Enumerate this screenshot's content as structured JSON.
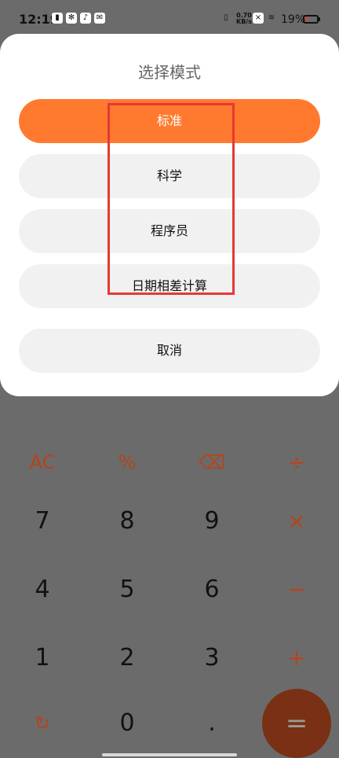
{
  "status": {
    "time": "12:19",
    "network_speed": "0.70 KB/s",
    "battery_percent": "19%",
    "icons": [
      "notification-icon",
      "settings-icon",
      "tiktok-icon",
      "mail-icon",
      "vibrate-icon",
      "close-icon",
      "wifi-icon",
      "battery-icon"
    ]
  },
  "modal": {
    "title": "选择模式",
    "options": [
      "标准",
      "科学",
      "程序员",
      "日期相差计算"
    ],
    "cancel": "取消",
    "selected_index": 0
  },
  "keypad": {
    "row1": [
      "AC",
      "%",
      "⌫",
      "÷"
    ],
    "row2": [
      "7",
      "8",
      "9",
      "×"
    ],
    "row3": [
      "4",
      "5",
      "6",
      "−"
    ],
    "row4": [
      "1",
      "2",
      "3",
      "+"
    ],
    "row5": [
      "↻",
      "0",
      ".",
      "="
    ]
  },
  "colors": {
    "accent": "#ff7a2f",
    "highlight": "#e53935",
    "overlay": "#6b6b6b",
    "operator": "#b6441a"
  }
}
